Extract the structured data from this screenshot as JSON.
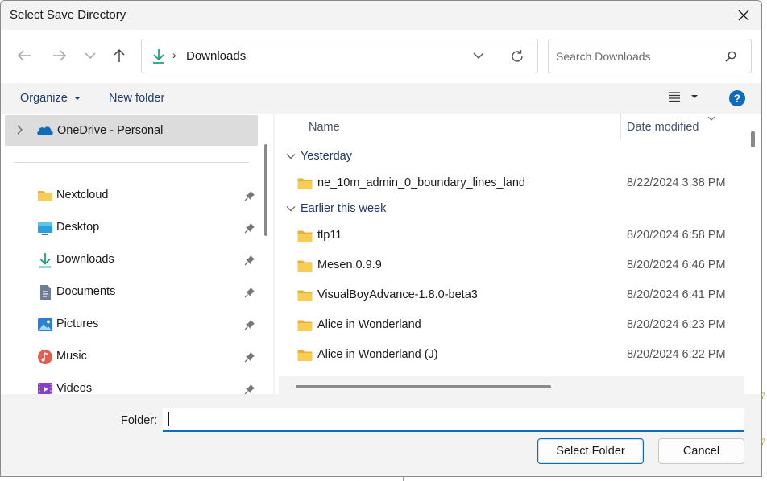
{
  "window": {
    "title": "Select Save Directory"
  },
  "nav": {
    "address_current": "Downloads",
    "search_placeholder": "Search Downloads"
  },
  "toolbar": {
    "organize_label": "Organize",
    "new_folder_label": "New folder",
    "help_label": "?"
  },
  "sidebar": {
    "onedrive_label": "OneDrive - Personal",
    "items": [
      {
        "label": "Nextcloud",
        "icon": "folder-icon",
        "pinned": true
      },
      {
        "label": "Desktop",
        "icon": "desktop-icon",
        "pinned": true
      },
      {
        "label": "Downloads",
        "icon": "download-icon",
        "pinned": true
      },
      {
        "label": "Documents",
        "icon": "documents-icon",
        "pinned": true
      },
      {
        "label": "Pictures",
        "icon": "pictures-icon",
        "pinned": true
      },
      {
        "label": "Music",
        "icon": "music-icon",
        "pinned": true
      },
      {
        "label": "Videos",
        "icon": "videos-icon",
        "pinned": true
      }
    ]
  },
  "file_list": {
    "columns": {
      "name": "Name",
      "date_modified": "Date modified"
    },
    "groups": [
      {
        "label": "Yesterday",
        "files": [
          {
            "name": "ne_10m_admin_0_boundary_lines_land",
            "date": "8/22/2024 3:38 PM"
          }
        ]
      },
      {
        "label": "Earlier this week",
        "files": [
          {
            "name": "tlp11",
            "date": "8/20/2024 6:58 PM"
          },
          {
            "name": "Mesen.0.9.9",
            "date": "8/20/2024 6:46 PM"
          },
          {
            "name": "VisualBoyAdvance-1.8.0-beta3",
            "date": "8/20/2024 6:41 PM"
          },
          {
            "name": "Alice in Wonderland",
            "date": "8/20/2024 6:23 PM"
          },
          {
            "name": "Alice in Wonderland (J)",
            "date": "8/20/2024 6:22 PM"
          }
        ]
      }
    ]
  },
  "footer": {
    "folder_label": "Folder:",
    "folder_value": "",
    "select_button": "Select Folder",
    "cancel_button": "Cancel"
  },
  "background": {
    "edge_mark_1": "7",
    "edge_mark_2": "7"
  },
  "colors": {
    "accent": "#0f6cbd",
    "folder_yellow": "#f4c542",
    "link_blue": "#1e3a6e"
  }
}
